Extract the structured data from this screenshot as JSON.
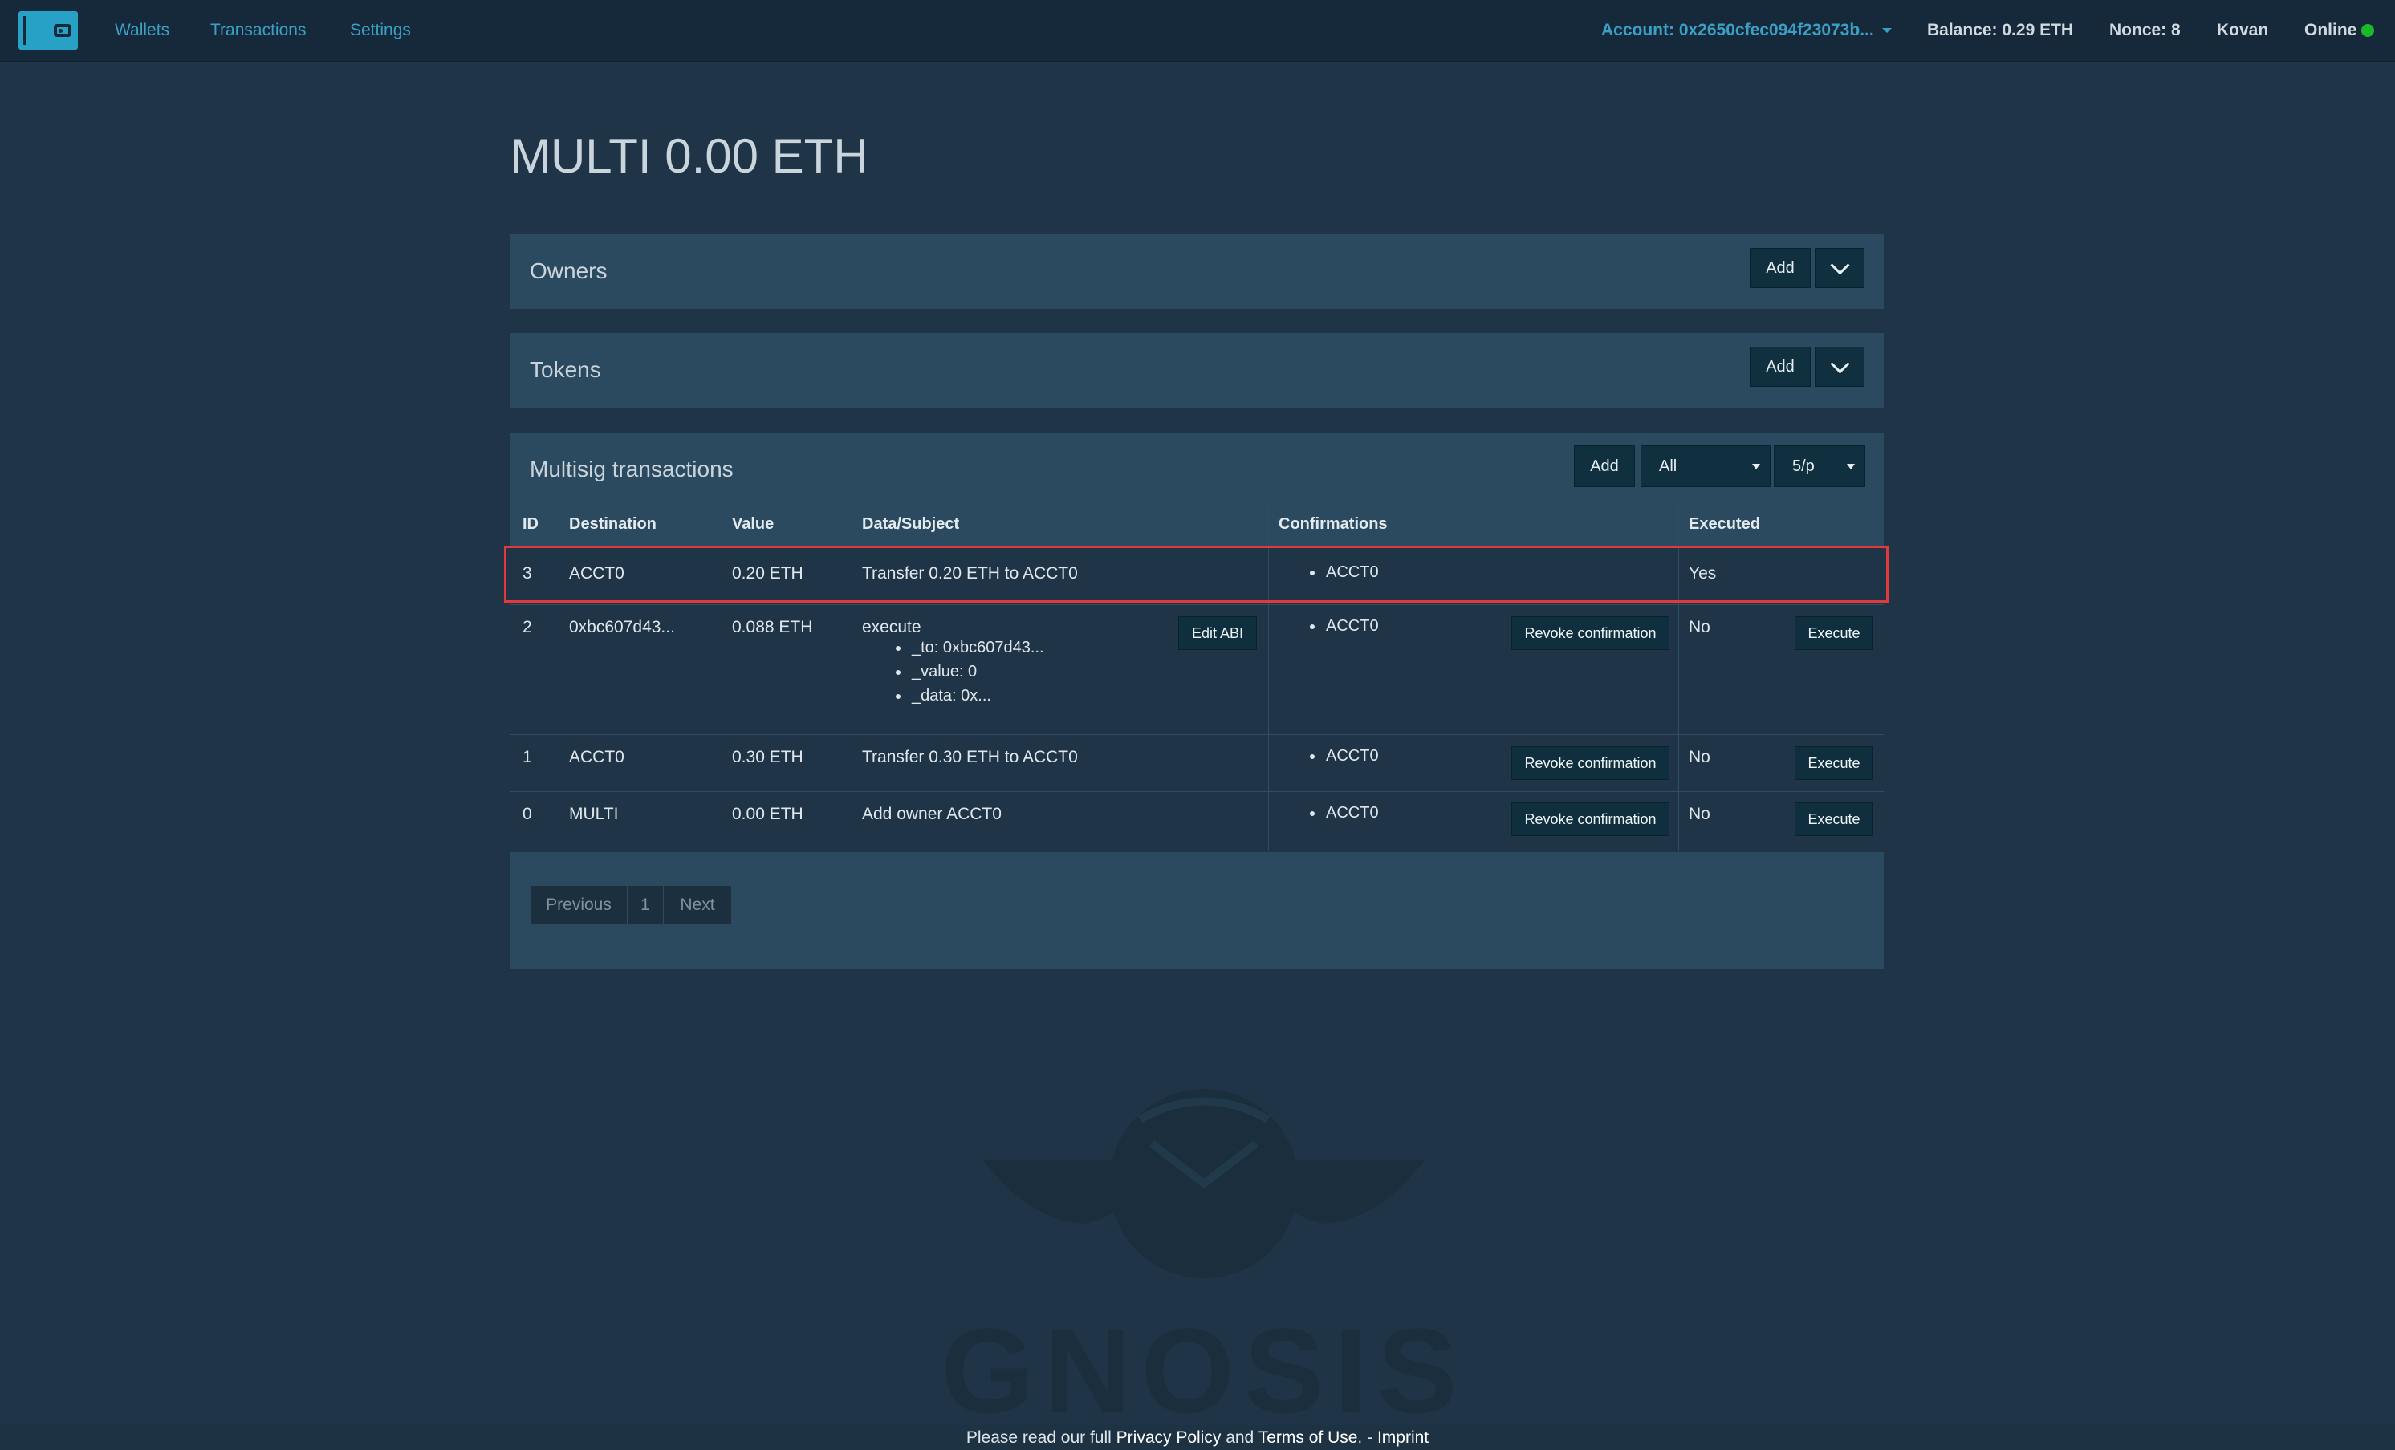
{
  "nav": {
    "links": [
      "Wallets",
      "Transactions",
      "Settings"
    ],
    "account": "Account: 0x2650cfec094f23073b...",
    "balance": "Balance: 0.29 ETH",
    "nonce": "Nonce: 8",
    "network": "Kovan",
    "status": "Online"
  },
  "page": {
    "title": "MULTI 0.00 ETH"
  },
  "owners": {
    "title": "Owners",
    "add_label": "Add"
  },
  "tokens": {
    "title": "Tokens",
    "add_label": "Add"
  },
  "multisig": {
    "title": "Multisig transactions",
    "add_label": "Add",
    "filter_value": "All",
    "page_size_value": "5/p",
    "columns": [
      "ID",
      "Destination",
      "Value",
      "Data/Subject",
      "Confirmations",
      "Executed"
    ],
    "rows": [
      {
        "id": "3",
        "destination": "ACCT0",
        "value": "0.20 ETH",
        "subject": "Transfer 0.20 ETH to ACCT0",
        "confirmations": [
          "ACCT0"
        ],
        "executed": "Yes"
      },
      {
        "id": "2",
        "destination": "0xbc607d43...",
        "value": "0.088 ETH",
        "subject": "execute",
        "params": [
          "_to: 0xbc607d43...",
          "_value: 0",
          "_data: 0x..."
        ],
        "confirmations": [
          "ACCT0"
        ],
        "executed": "No"
      },
      {
        "id": "1",
        "destination": "ACCT0",
        "value": "0.30 ETH",
        "subject": "Transfer 0.30 ETH to ACCT0",
        "confirmations": [
          "ACCT0"
        ],
        "executed": "No"
      },
      {
        "id": "0",
        "destination": "MULTI",
        "value": "0.00 ETH",
        "subject": "Add owner ACCT0",
        "confirmations": [
          "ACCT0"
        ],
        "executed": "No"
      }
    ],
    "edit_abi_label": "Edit ABI",
    "revoke_label": "Revoke confirmation",
    "execute_label": "Execute",
    "pagination": {
      "previous": "Previous",
      "page": "1",
      "next": "Next"
    }
  },
  "watermark": "GNOSIS",
  "footer": {
    "prefix": "Please read our full",
    "privacy": "Privacy Policy",
    "and": "and",
    "terms": "Terms of Use",
    "sep": ". -",
    "imprint": "Imprint"
  },
  "colors": {
    "accent": "#3aa0c5",
    "online": "#1db82a",
    "highlight": "#e23a3a"
  }
}
